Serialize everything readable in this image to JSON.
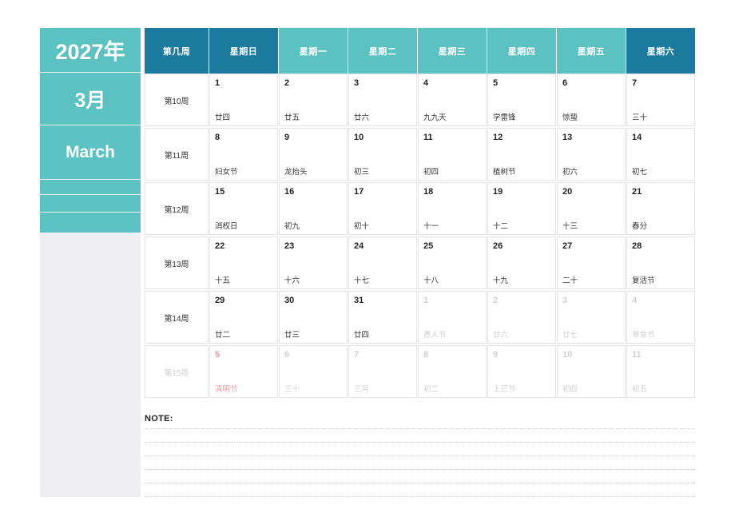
{
  "sidebar": {
    "year": "2027年",
    "month_cn": "3月",
    "month_en": "March"
  },
  "header": {
    "week_col": "第几周",
    "days": [
      {
        "label": "星期日",
        "tone": "dark"
      },
      {
        "label": "星期一",
        "tone": "light"
      },
      {
        "label": "星期二",
        "tone": "light"
      },
      {
        "label": "星期三",
        "tone": "light"
      },
      {
        "label": "星期四",
        "tone": "light"
      },
      {
        "label": "星期五",
        "tone": "light"
      },
      {
        "label": "星期六",
        "tone": "dark"
      }
    ]
  },
  "weeks": [
    {
      "week_label": "第10周",
      "days": [
        {
          "num": "1",
          "lunar": "廿四",
          "state": "normal"
        },
        {
          "num": "2",
          "lunar": "廿五",
          "state": "normal"
        },
        {
          "num": "3",
          "lunar": "廿六",
          "state": "normal"
        },
        {
          "num": "4",
          "lunar": "九九天",
          "state": "normal"
        },
        {
          "num": "5",
          "lunar": "学雷锋",
          "state": "normal"
        },
        {
          "num": "6",
          "lunar": "惊蛰",
          "state": "normal"
        },
        {
          "num": "7",
          "lunar": "三十",
          "state": "normal"
        }
      ]
    },
    {
      "week_label": "第11周",
      "days": [
        {
          "num": "8",
          "lunar": "妇女节",
          "state": "normal"
        },
        {
          "num": "9",
          "lunar": "龙抬头",
          "state": "normal"
        },
        {
          "num": "10",
          "lunar": "初三",
          "state": "normal"
        },
        {
          "num": "11",
          "lunar": "初四",
          "state": "normal"
        },
        {
          "num": "12",
          "lunar": "植树节",
          "state": "normal"
        },
        {
          "num": "13",
          "lunar": "初六",
          "state": "normal"
        },
        {
          "num": "14",
          "lunar": "初七",
          "state": "normal"
        }
      ]
    },
    {
      "week_label": "第12周",
      "days": [
        {
          "num": "15",
          "lunar": "消权日",
          "state": "normal"
        },
        {
          "num": "16",
          "lunar": "初九",
          "state": "normal"
        },
        {
          "num": "17",
          "lunar": "初十",
          "state": "normal"
        },
        {
          "num": "18",
          "lunar": "十一",
          "state": "normal"
        },
        {
          "num": "19",
          "lunar": "十二",
          "state": "normal"
        },
        {
          "num": "20",
          "lunar": "十三",
          "state": "normal"
        },
        {
          "num": "21",
          "lunar": "春分",
          "state": "normal"
        }
      ]
    },
    {
      "week_label": "第13周",
      "days": [
        {
          "num": "22",
          "lunar": "十五",
          "state": "normal"
        },
        {
          "num": "23",
          "lunar": "十六",
          "state": "normal"
        },
        {
          "num": "24",
          "lunar": "十七",
          "state": "normal"
        },
        {
          "num": "25",
          "lunar": "十八",
          "state": "normal"
        },
        {
          "num": "26",
          "lunar": "十九",
          "state": "normal"
        },
        {
          "num": "27",
          "lunar": "二十",
          "state": "normal"
        },
        {
          "num": "28",
          "lunar": "复活节",
          "state": "normal"
        }
      ]
    },
    {
      "week_label": "第14周",
      "days": [
        {
          "num": "29",
          "lunar": "廿二",
          "state": "normal"
        },
        {
          "num": "30",
          "lunar": "廿三",
          "state": "normal"
        },
        {
          "num": "31",
          "lunar": "廿四",
          "state": "normal"
        },
        {
          "num": "1",
          "lunar": "愚人节",
          "state": "muted"
        },
        {
          "num": "2",
          "lunar": "廿六",
          "state": "muted"
        },
        {
          "num": "3",
          "lunar": "廿七",
          "state": "muted"
        },
        {
          "num": "4",
          "lunar": "寒食节",
          "state": "muted"
        }
      ]
    },
    {
      "week_label": "第15周",
      "week_muted": true,
      "days": [
        {
          "num": "5",
          "lunar": "清明节",
          "state": "holiday"
        },
        {
          "num": "6",
          "lunar": "三十",
          "state": "muted"
        },
        {
          "num": "7",
          "lunar": "三月",
          "state": "muted"
        },
        {
          "num": "8",
          "lunar": "初二",
          "state": "muted"
        },
        {
          "num": "9",
          "lunar": "上巳节",
          "state": "muted"
        },
        {
          "num": "10",
          "lunar": "初四",
          "state": "muted"
        },
        {
          "num": "11",
          "lunar": "初五",
          "state": "muted"
        }
      ]
    }
  ],
  "note": {
    "label": "NOTE:",
    "line_count": 6
  },
  "colors": {
    "header_dark": "#1b7a9e",
    "header_light": "#5cc1c1",
    "sidebar_teal": "#5cc1c1",
    "sidebar_grey": "#eeeef2",
    "holiday_red": "#f19a9f",
    "cell_border": "#e2e3e8"
  }
}
